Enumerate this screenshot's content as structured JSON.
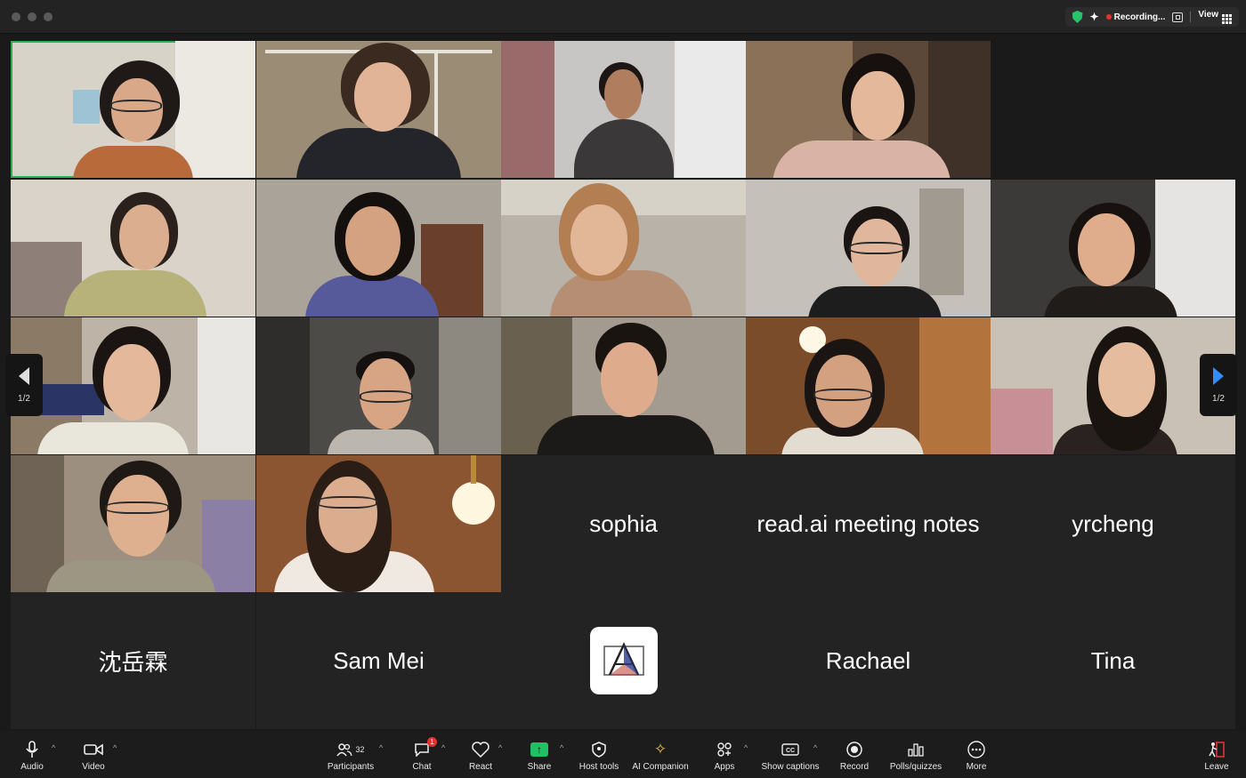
{
  "titlebar": {
    "recording_label": "Recording...",
    "view_label": "View"
  },
  "participants": [
    {
      "id": "p1",
      "type": "video"
    },
    {
      "id": "p2",
      "type": "video"
    },
    {
      "id": "p3",
      "type": "video"
    },
    {
      "id": "p4",
      "type": "video"
    },
    {
      "id": "p5",
      "type": "video"
    },
    {
      "id": "p6",
      "type": "video"
    },
    {
      "id": "p7",
      "type": "video"
    },
    {
      "id": "p8",
      "type": "video"
    },
    {
      "id": "p9",
      "type": "video"
    },
    {
      "id": "p10",
      "type": "video"
    },
    {
      "id": "p11",
      "type": "video"
    },
    {
      "id": "p12",
      "type": "video"
    },
    {
      "id": "p13",
      "type": "video"
    },
    {
      "id": "p14",
      "type": "video"
    },
    {
      "id": "p15",
      "type": "video"
    },
    {
      "id": "p16",
      "type": "video"
    },
    {
      "id": "p17",
      "type": "video"
    },
    {
      "name": "sophia"
    },
    {
      "name": "read.ai meeting notes"
    },
    {
      "name": "yrcheng"
    },
    {
      "name": "沈岳霖"
    },
    {
      "name": "Sam Mei"
    },
    {
      "name": "",
      "avatar": "logo"
    },
    {
      "name": "Rachael"
    },
    {
      "name": "Tina"
    }
  ],
  "pager": {
    "left_label": "1/2",
    "right_label": "1/2"
  },
  "toolbar": {
    "audio": "Audio",
    "video": "Video",
    "participants": "Participants",
    "participant_count": "32",
    "chat": "Chat",
    "chat_badge": "1",
    "react": "React",
    "share": "Share",
    "host_tools": "Host tools",
    "ai_companion": "AI Companion",
    "apps": "Apps",
    "show_captions": "Show captions",
    "record": "Record",
    "polls": "Polls/quizzes",
    "more": "More",
    "leave": "Leave"
  },
  "colors": {
    "active_speaker": "#2bb24c",
    "share_green": "#21c064",
    "recording_red": "#e5322d",
    "pager_accent": "#2f8fff"
  }
}
